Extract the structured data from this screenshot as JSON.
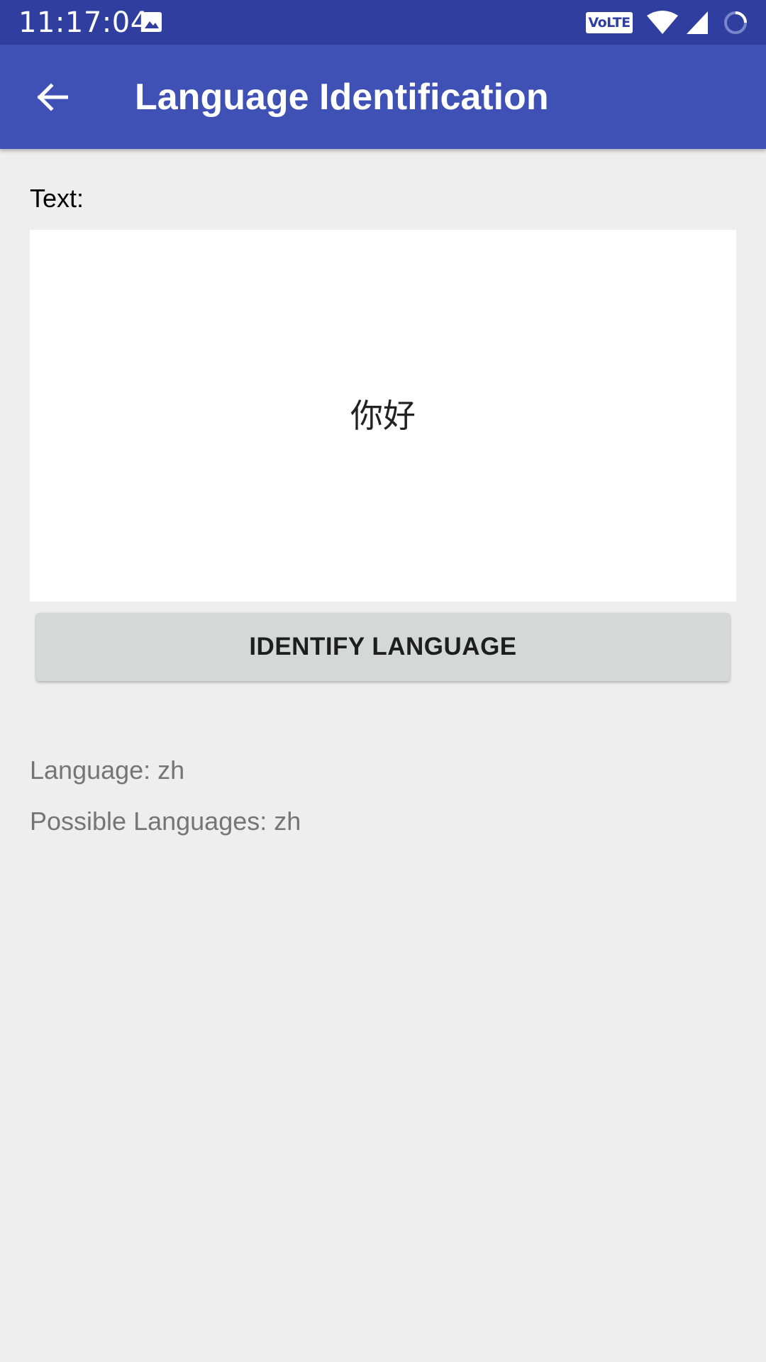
{
  "status_bar": {
    "time": "11:17:04",
    "volte": "VoLTE",
    "icons": [
      "image-icon",
      "volte-icon",
      "wifi-icon",
      "signal-icon",
      "battery-icon"
    ]
  },
  "app_bar": {
    "title": "Language Identification",
    "back_icon": "arrow-left-icon"
  },
  "form": {
    "text_label": "Text:",
    "text_value": "你好",
    "button_label": "IDENTIFY LANGUAGE"
  },
  "results": {
    "language": "Language: zh",
    "possible_languages": "Possible Languages: zh"
  },
  "colors": {
    "status_bar": "#303f9f",
    "app_bar": "#3f51b5",
    "background": "#eeeeee",
    "button": "#d6d7d7",
    "result_text": "#757575"
  }
}
